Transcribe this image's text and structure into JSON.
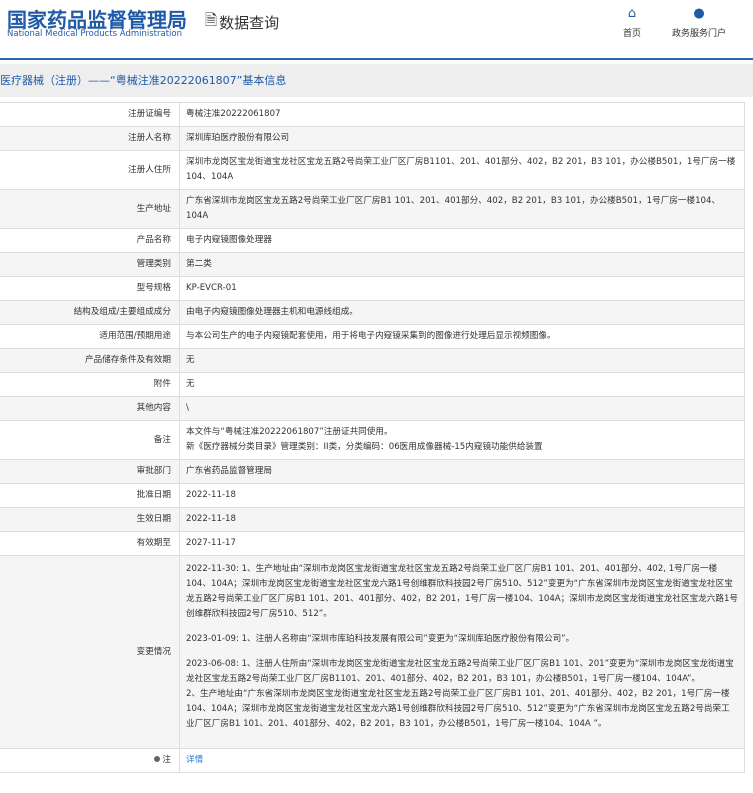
{
  "header": {
    "logo_cn": "国家药品监督管理局",
    "logo_en": "National Medical Products Administration",
    "data_query": "数据查询",
    "nav": [
      {
        "label": "首页",
        "icon": "home-icon"
      },
      {
        "label": "政务服务门户",
        "icon": "user-icon"
      }
    ]
  },
  "page_title": "医疗器械（注册）——“粤械注准20222061807”基本信息",
  "rows": [
    {
      "label": "注册证编号",
      "value": "粤械注准20222061807"
    },
    {
      "label": "注册人名称",
      "value": "深圳库珀医疗股份有限公司"
    },
    {
      "label": "注册人住所",
      "value": "深圳市龙岗区宝龙街道宝龙社区宝龙五路2号尚荣工业厂区厂房B1101、201、401部分、402，B2 201，B3 101，办公楼B501，1号厂房一楼104、104A"
    },
    {
      "label": "生产地址",
      "value": "广东省深圳市龙岗区宝龙五路2号尚荣工业厂区厂房B1 101、201、401部分、402，B2 201，B3 101，办公楼B501，1号厂房一楼104、104A"
    },
    {
      "label": "产品名称",
      "value": "电子内窥镜图像处理器"
    },
    {
      "label": "管理类别",
      "value": "第二类"
    },
    {
      "label": "型号规格",
      "value": "KP-EVCR-01"
    },
    {
      "label": "结构及组成/主要组成成分",
      "value": "由电子内窥镜图像处理器主机和电源线组成。"
    },
    {
      "label": "适用范围/预期用途",
      "value": "与本公司生产的电子内窥镜配套使用，用于将电子内窥镜采集到的图像进行处理后显示视频图像。"
    },
    {
      "label": "产品储存条件及有效期",
      "value": "无"
    },
    {
      "label": "附件",
      "value": "无"
    },
    {
      "label": "其他内容",
      "value": "\\"
    }
  ],
  "remark": {
    "label": "备注",
    "lines": [
      "本文件与“粤械注准20222061807”注册证共同使用。",
      "新《医疗器械分类目录》管理类别：II类，分类编码：06医用成像器械-15内窥镜功能供给装置"
    ]
  },
  "rows2": [
    {
      "label": "审批部门",
      "value": "广东省药品监督管理局"
    },
    {
      "label": "批准日期",
      "value": "2022-11-18"
    },
    {
      "label": "生效日期",
      "value": "2022-11-18"
    },
    {
      "label": "有效期至",
      "value": "2027-11-17"
    }
  ],
  "changes": {
    "label": "变更情况",
    "entries": [
      "2022-11-30: 1、生产地址由“深圳市龙岗区宝龙街道宝龙社区宝龙五路2号尚荣工业厂区厂房B1 101、201、401部分、402, 1号厂房一楼104、104A；深圳市龙岗区宝龙街道宝龙社区宝龙六路1号创维群欣科技园2号厂房510、512”变更为“广东省深圳市龙岗区宝龙街道宝龙社区宝龙五路2号尚荣工业厂区厂房B1 101、201、401部分、402，B2 201，1号厂房一楼104、104A；深圳市龙岗区宝龙街道宝龙社区宝龙六路1号创维群欣科技园2号厂房510、512”。",
      "2023-01-09: 1、注册人名称由“深圳市库珀科技发展有限公司”变更为“深圳库珀医疗股份有限公司”。",
      "2023-06-08: 1、注册人住所由“深圳市龙岗区宝龙街道宝龙社区宝龙五路2号尚荣工业厂区厂房B1 101、201”变更为“深圳市龙岗区宝龙街道宝龙社区宝龙五路2号尚荣工业厂区厂房B1101、201、401部分、402，B2 201，B3 101，办公楼B501，1号厂房一楼104、104A”。",
      "2、生产地址由“广东省深圳市龙岗区宝龙街道宝龙社区宝龙五路2号尚荣工业厂区厂房B1 101、201、401部分、402，B2 201，1号厂房一楼104、104A；深圳市龙岗区宝龙街道宝龙社区宝龙六路1号创维群欣科技园2号厂房510、512”变更为“广东省深圳市龙岗区宝龙五路2号尚荣工业厂区厂房B1 101、201、401部分、402，B2 201，B3 101，办公楼B501，1号厂房一楼104、104A ”。"
    ]
  },
  "note": {
    "label": "注",
    "link": "详情"
  }
}
